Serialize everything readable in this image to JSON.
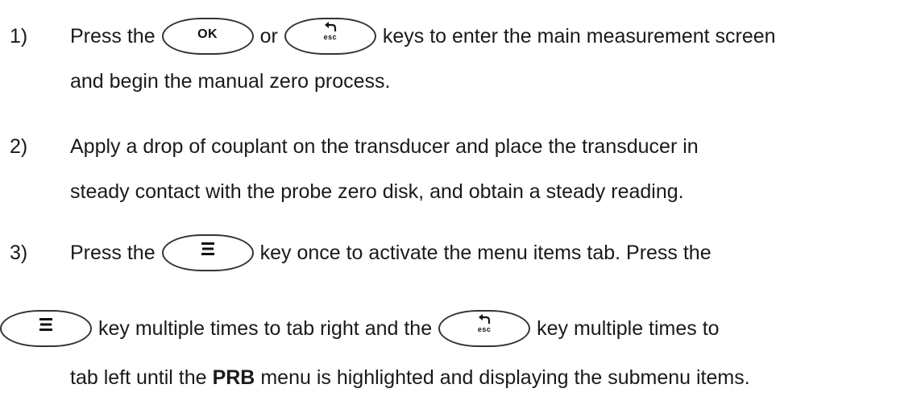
{
  "keys": {
    "ok_label": "OK",
    "esc_label": "esc"
  },
  "steps": [
    {
      "number": "1)",
      "line1_a": "Press the",
      "line1_b": "or",
      "line1_c": "keys to enter the main measurement screen",
      "line2": "and begin the manual zero process."
    },
    {
      "number": "2)",
      "line1": "Apply a drop of couplant on the transducer and place the transducer in",
      "line2": "steady contact with the probe zero disk, and obtain a steady reading."
    },
    {
      "number": "3)",
      "line1_a": "Press the",
      "line1_b": "key once to activate the menu items tab.  Press the",
      "line2_a": "key multiple times to tab right and the",
      "line2_b": "key multiple times to",
      "line3_a": "tab left until the",
      "line3_bold": "PRB",
      "line3_b": "menu is highlighted and displaying the submenu items."
    }
  ]
}
